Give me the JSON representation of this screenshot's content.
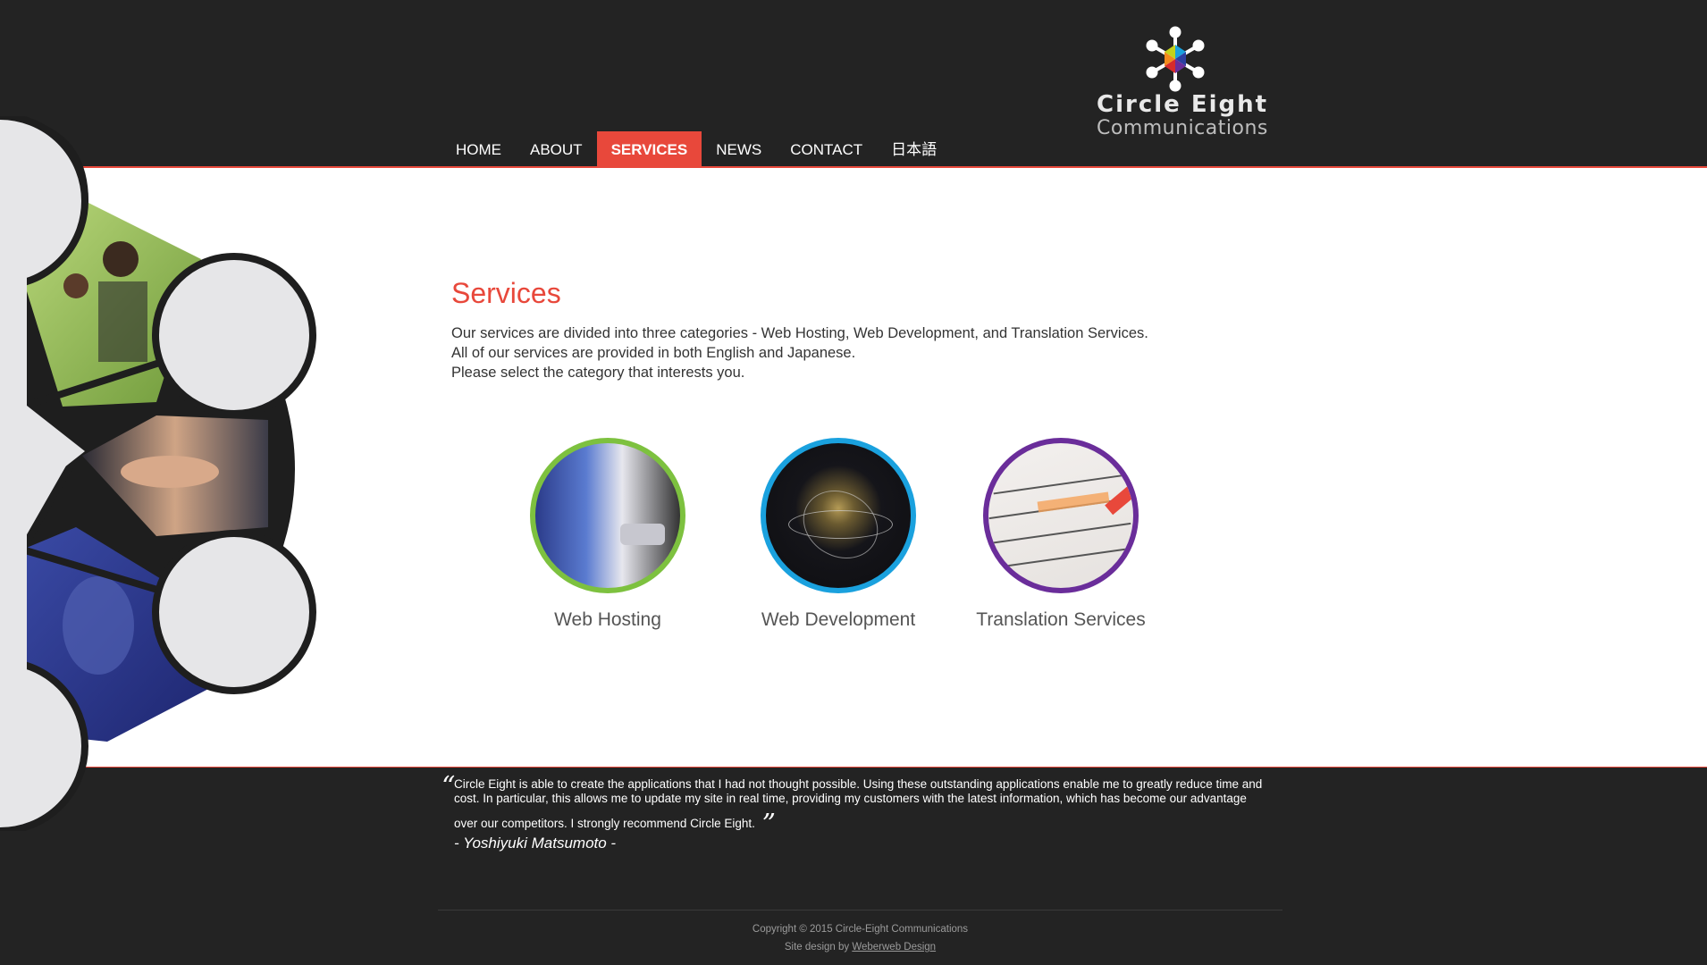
{
  "brand": {
    "line1": "Circle  Eight",
    "line2": "Communications"
  },
  "nav": {
    "items": [
      {
        "label": "HOME"
      },
      {
        "label": "ABOUT"
      },
      {
        "label": "SERVICES"
      },
      {
        "label": "NEWS"
      },
      {
        "label": "CONTACT"
      },
      {
        "label": "日本語"
      }
    ],
    "active": "SERVICES"
  },
  "page": {
    "title": "Services",
    "intro": [
      "Our services are divided into three categories - Web Hosting, Web Development, and Translation Services.",
      "All of our services are provided in both English and Japanese.",
      "Please select the category that interests you."
    ]
  },
  "services": [
    {
      "label": "Web Hosting",
      "ring_color": "#7dc13f"
    },
    {
      "label": "Web Development",
      "ring_color": "#1aa1de"
    },
    {
      "label": "Translation Services",
      "ring_color": "#6a2d9a"
    }
  ],
  "testimonial": {
    "text": "Circle Eight is able to create the applications that I had not thought possible. Using these outstanding applications enable me to greatly reduce time and cost. In particular, this allows me to update my site in real time, providing my customers with the latest information, which has become our advantage over our competitors. I strongly recommend Circle Eight.",
    "author": "- Yoshiyuki Matsumoto -"
  },
  "footer": {
    "copyright": "Copyright © 2015 Circle-Eight Communications",
    "design_prefix": "Site design by ",
    "design_link": "Weberweb Design"
  },
  "colors": {
    "accent": "#e8483b",
    "background": "#232323",
    "panel": "#ffffff"
  }
}
